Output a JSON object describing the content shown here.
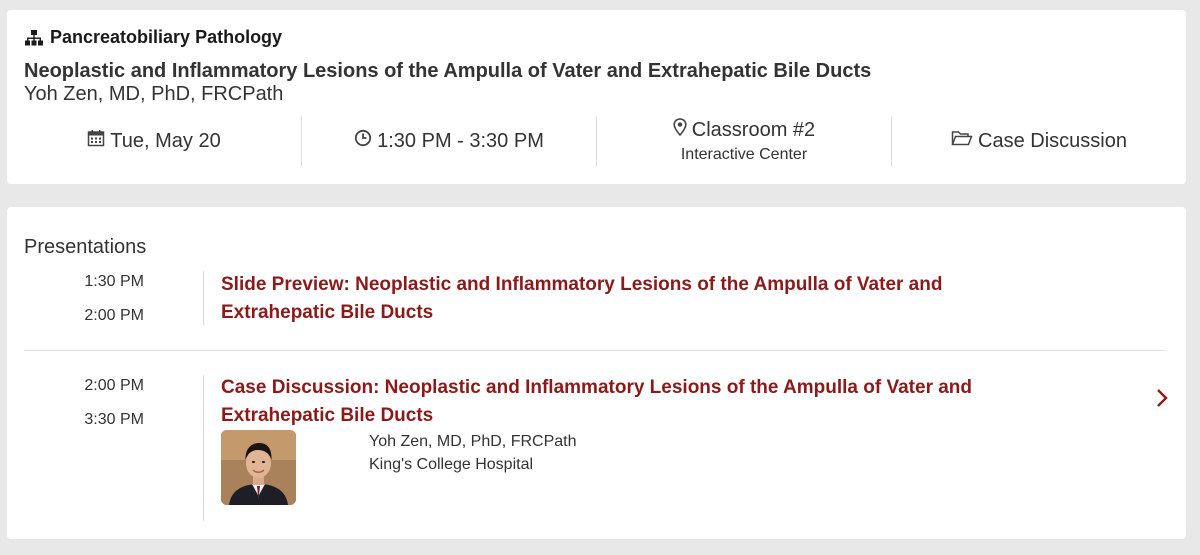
{
  "header": {
    "track": "Pancreatobiliary Pathology",
    "title": "Neoplastic and Inflammatory Lesions of the Ampulla of Vater and Extrahepatic Bile Ducts",
    "speaker": "Yoh Zen, MD, PhD, FRCPath",
    "date": "Tue, May 20",
    "time": "1:30 PM - 3:30 PM",
    "location": "Classroom #2",
    "location_sub": "Interactive Center",
    "type": "Case Discussion"
  },
  "presentations": {
    "heading": "Presentations",
    "items": [
      {
        "start": "1:30 PM",
        "end": "2:00 PM",
        "title_line1": "Slide Preview: Neoplastic and Inflammatory Lesions of the Ampulla of Vater and",
        "title_line2": "Extrahepatic Bile Ducts"
      },
      {
        "start": "2:00 PM",
        "end": "3:30 PM",
        "title_line1": "Case Discussion: Neoplastic and Inflammatory Lesions of the Ampulla of Vater and",
        "title_line2": "Extrahepatic Bile Ducts",
        "speaker_name": "Yoh Zen, MD, PhD, FRCPath",
        "speaker_org": "King's College Hospital"
      }
    ]
  },
  "colors": {
    "accent": "#8b1a1a",
    "background": "#e8e8e8",
    "card": "#ffffff"
  },
  "icons": [
    "sitemap-icon",
    "calendar-icon",
    "clock-icon",
    "map-marker-icon",
    "folder-open-icon",
    "chevron-right-icon"
  ]
}
